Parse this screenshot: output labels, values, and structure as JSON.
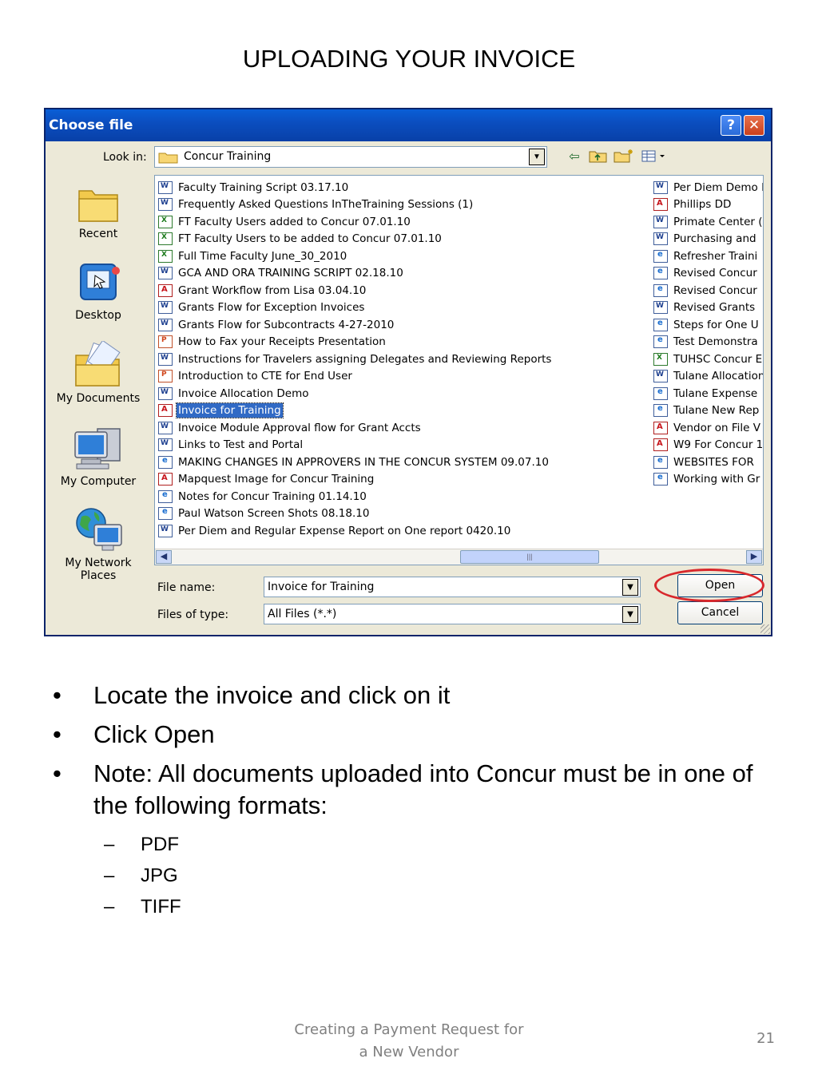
{
  "slide": {
    "title": "UPLOADING YOUR INVOICE",
    "footer_line1": "Creating a Payment Request for",
    "footer_line2": "a New Vendor",
    "page_number": "21"
  },
  "dialog": {
    "title": "Choose file",
    "help_glyph": "?",
    "close_glyph": "✕",
    "look_in_label": "Look in:",
    "look_in_value": "Concur Training",
    "file_name_label": "File name:",
    "file_name_value": "Invoice for Training",
    "files_of_type_label": "Files of type:",
    "files_of_type_value": "All Files (*.*)",
    "open_label": "Open",
    "cancel_label": "Cancel",
    "highlight_color": "#d8282c",
    "selection_color": "#316ac5"
  },
  "places": [
    {
      "label": "Recent",
      "icon": "recent-folder-icon"
    },
    {
      "label": "Desktop",
      "icon": "desktop-icon"
    },
    {
      "label": "My Documents",
      "icon": "my-documents-icon"
    },
    {
      "label": "My Computer",
      "icon": "my-computer-icon"
    },
    {
      "label": "My Network Places",
      "icon": "network-places-icon"
    }
  ],
  "files_col1": [
    {
      "name": "Faculty Training Script 03.17.10",
      "type": "doc"
    },
    {
      "name": "Frequently Asked Questions InTheTraining Sessions (1)",
      "type": "doc"
    },
    {
      "name": "FT Faculty Users added to Concur 07.01.10",
      "type": "xls"
    },
    {
      "name": "FT Faculty Users to be added to Concur 07.01.10",
      "type": "xls"
    },
    {
      "name": "Full Time Faculty June_30_2010",
      "type": "xls"
    },
    {
      "name": "GCA AND ORA TRAINING SCRIPT 02.18.10",
      "type": "doc"
    },
    {
      "name": "Grant Workflow from Lisa 03.04.10",
      "type": "pdf"
    },
    {
      "name": "Grants Flow for Exception Invoices",
      "type": "doc"
    },
    {
      "name": "Grants Flow for Subcontracts 4-27-2010",
      "type": "doc"
    },
    {
      "name": "How to Fax your Receipts Presentation",
      "type": "ppt"
    },
    {
      "name": "Instructions for Travelers assigning Delegates and Reviewing Reports",
      "type": "doc"
    },
    {
      "name": "Introduction to CTE for End User",
      "type": "ppt"
    },
    {
      "name": "Invoice Allocation Demo",
      "type": "doc"
    },
    {
      "name": "Invoice for Training",
      "type": "pdf",
      "selected": true
    },
    {
      "name": "Invoice Module Approval flow for Grant Accts",
      "type": "doc"
    },
    {
      "name": "Links to Test and Portal",
      "type": "doc"
    },
    {
      "name": "MAKING CHANGES IN APPROVERS IN THE CONCUR SYSTEM 09.07.10",
      "type": "mht"
    },
    {
      "name": "Mapquest Image for Concur Training",
      "type": "pdf"
    },
    {
      "name": "Notes for Concur Training 01.14.10",
      "type": "mht"
    },
    {
      "name": "Paul Watson Screen Shots 08.18.10",
      "type": "mht"
    },
    {
      "name": "Per Diem and Regular Expense Report on One report 0420.10",
      "type": "doc"
    }
  ],
  "files_col2": [
    {
      "name": "Per Diem Demo I",
      "type": "doc"
    },
    {
      "name": "Phillips DD",
      "type": "pdf"
    },
    {
      "name": "Primate Center (",
      "type": "doc"
    },
    {
      "name": "Purchasing and",
      "type": "doc"
    },
    {
      "name": "Refresher Traini",
      "type": "mht"
    },
    {
      "name": "Revised Concur",
      "type": "mht"
    },
    {
      "name": "Revised Concur",
      "type": "mht"
    },
    {
      "name": "Revised Grants",
      "type": "doc"
    },
    {
      "name": "Steps for One U",
      "type": "mht"
    },
    {
      "name": "Test Demonstra",
      "type": "mht"
    },
    {
      "name": "TUHSC Concur E",
      "type": "xls"
    },
    {
      "name": "Tulane Allocation",
      "type": "doc"
    },
    {
      "name": "Tulane Expense",
      "type": "mht"
    },
    {
      "name": "Tulane New Rep",
      "type": "mht"
    },
    {
      "name": "Vendor on File V",
      "type": "pdf"
    },
    {
      "name": "W9 For Concur 1",
      "type": "pdf"
    },
    {
      "name": "WEBSITES FOR",
      "type": "mht"
    },
    {
      "name": "Working with Gr",
      "type": "mht"
    }
  ],
  "bullets": [
    "Locate the  invoice and click on it",
    "Click Open",
    "Note: All documents uploaded into Concur must be in one of the following formats:"
  ],
  "formats": [
    "PDF",
    "JPG",
    "TIFF"
  ]
}
